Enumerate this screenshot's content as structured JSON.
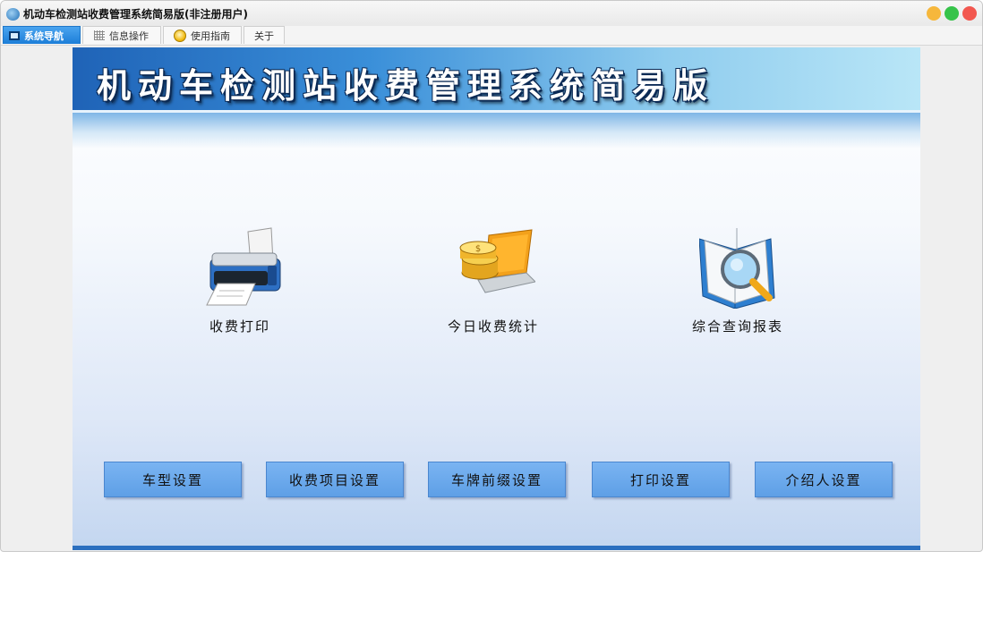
{
  "window": {
    "title": "机动车检测站收费管理系统简易版(非注册用户)"
  },
  "tabs": [
    {
      "label": "系统导航",
      "icon": "monitor-icon",
      "active": true
    },
    {
      "label": "信息操作",
      "icon": "grid-icon",
      "active": false
    },
    {
      "label": "使用指南",
      "icon": "lightbulb-icon",
      "active": false
    },
    {
      "label": "关于",
      "icon": "",
      "active": false
    }
  ],
  "banner": {
    "title": "机动车检测站收费管理系统简易版"
  },
  "tiles": [
    {
      "label": "收费打印",
      "icon": "printer-icon"
    },
    {
      "label": "今日收费统计",
      "icon": "coins-laptop-icon"
    },
    {
      "label": "综合查询报表",
      "icon": "book-magnifier-icon"
    }
  ],
  "buttons": [
    {
      "label": "车型设置"
    },
    {
      "label": "收费项目设置"
    },
    {
      "label": "车牌前缀设置"
    },
    {
      "label": "打印设置"
    },
    {
      "label": "介绍人设置"
    }
  ],
  "colors": {
    "accent": "#1c7ed8",
    "button": "#6aa8ec",
    "banner_dark": "#1f63b7"
  }
}
